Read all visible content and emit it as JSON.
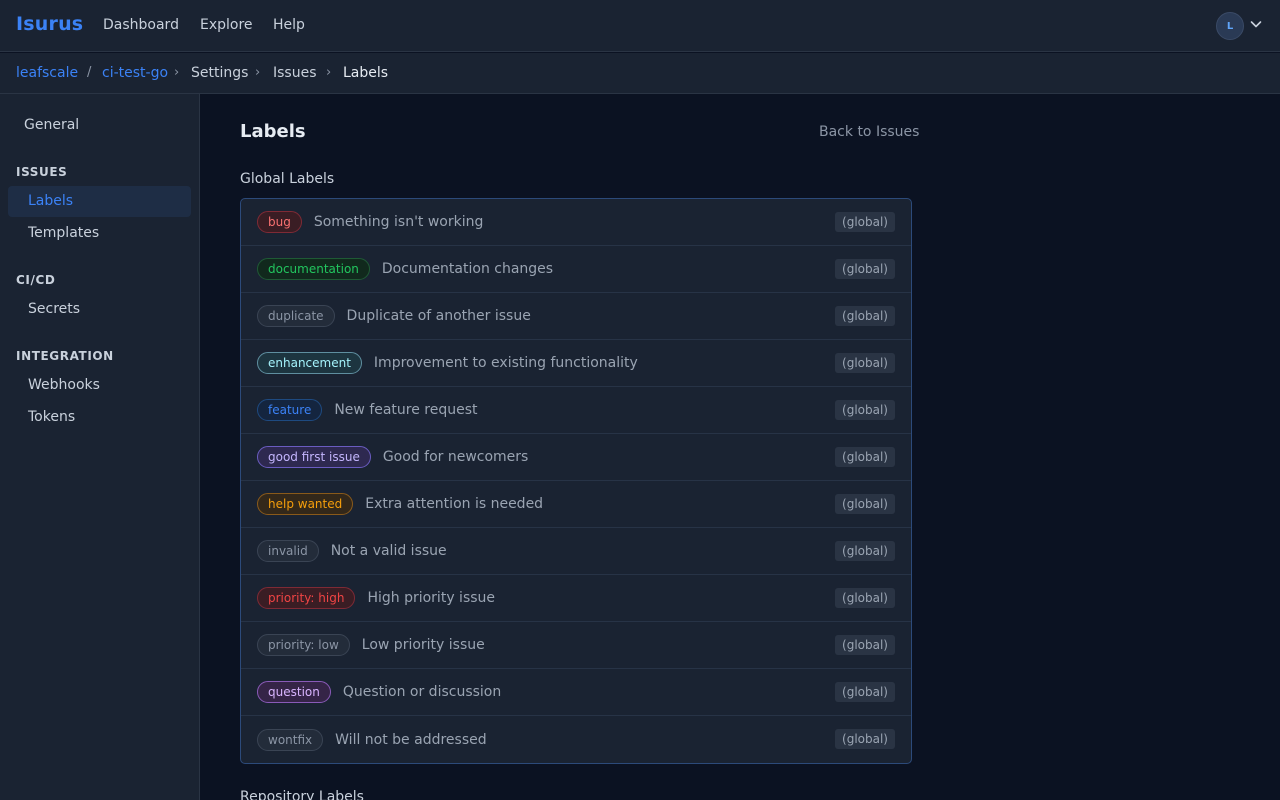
{
  "app": {
    "brand": "Isurus",
    "nav": [
      "Dashboard",
      "Explore",
      "Help"
    ],
    "avatar_initial": "L"
  },
  "breadcrumb": {
    "owner": "leafscale",
    "repo": "ci-test-go",
    "settings": "Settings",
    "issues": "Issues",
    "current": "Labels"
  },
  "sidebar": {
    "general": "General",
    "issues_heading": "ISSUES",
    "labels": "Labels",
    "templates": "Templates",
    "cicd_heading": "CI/CD",
    "secrets": "Secrets",
    "integration_heading": "INTEGRATION",
    "webhooks": "Webhooks",
    "tokens": "Tokens"
  },
  "main": {
    "title": "Labels",
    "back_link": "Back to Issues",
    "global_section": "Global Labels",
    "repo_section": "Repository Labels",
    "scope_text": "(global)",
    "labels": [
      {
        "name": "bug",
        "description": "Something isn't working",
        "color": "#f87171",
        "bg": "#3a1d24",
        "border": "#7f2a35"
      },
      {
        "name": "documentation",
        "description": "Documentation changes",
        "color": "#22c55e",
        "bg": "#11291d",
        "border": "#1f5a35"
      },
      {
        "name": "duplicate",
        "description": "Duplicate of another issue",
        "color": "#8b95a5",
        "bg": "#232c3a",
        "border": "#3a4454"
      },
      {
        "name": "enhancement",
        "description": "Improvement to existing functionality",
        "color": "#a5f3fc",
        "bg": "#1d3540",
        "border": "#5f8fa0"
      },
      {
        "name": "feature",
        "description": "New feature request",
        "color": "#3b82f6",
        "bg": "#14253f",
        "border": "#1e4a80"
      },
      {
        "name": "good first issue",
        "description": "Good for newcomers",
        "color": "#c4b5fd",
        "bg": "#2e2950",
        "border": "#6a5cc0"
      },
      {
        "name": "help wanted",
        "description": "Extra attention is needed",
        "color": "#f59e0b",
        "bg": "#33281a",
        "border": "#8a5a1a"
      },
      {
        "name": "invalid",
        "description": "Not a valid issue",
        "color": "#8b95a5",
        "bg": "#232c3a",
        "border": "#3a4454"
      },
      {
        "name": "priority: high",
        "description": "High priority issue",
        "color": "#ef4444",
        "bg": "#3a1d24",
        "border": "#7f2a35"
      },
      {
        "name": "priority: low",
        "description": "Low priority issue",
        "color": "#8b95a5",
        "bg": "#232c3a",
        "border": "#3a4454"
      },
      {
        "name": "question",
        "description": "Question or discussion",
        "color": "#d8b4fe",
        "bg": "#352447",
        "border": "#8a5ab8"
      },
      {
        "name": "wontfix",
        "description": "Will not be addressed",
        "color": "#8b95a5",
        "bg": "#232c3a",
        "border": "#3a4454"
      }
    ]
  }
}
